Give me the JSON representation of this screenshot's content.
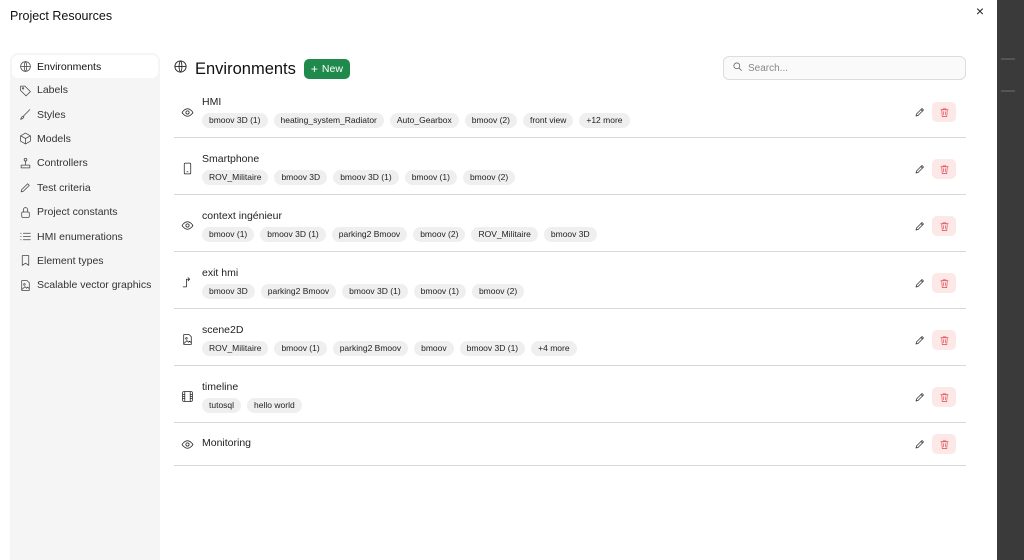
{
  "modal": {
    "title": "Project Resources",
    "close_glyph": "×"
  },
  "sidebar": {
    "items": [
      {
        "label": "Environments",
        "icon": "globe-icon",
        "active": true
      },
      {
        "label": "Labels",
        "icon": "tag-icon"
      },
      {
        "label": "Styles",
        "icon": "brush-icon"
      },
      {
        "label": "Models",
        "icon": "cube-icon"
      },
      {
        "label": "Controllers",
        "icon": "joystick-icon"
      },
      {
        "label": "Test criteria",
        "icon": "pencil-icon"
      },
      {
        "label": "Project constants",
        "icon": "lock-icon"
      },
      {
        "label": "HMI enumerations",
        "icon": "list-icon"
      },
      {
        "label": "Element types",
        "icon": "bookmark-icon"
      },
      {
        "label": "Scalable vector graphics",
        "icon": "image-file-icon"
      }
    ]
  },
  "main": {
    "title": "Environments",
    "title_icon": "globe-icon",
    "new_label": "New",
    "new_glyph": "+"
  },
  "search": {
    "placeholder": "Search..."
  },
  "environments": [
    {
      "name": "HMI",
      "icon": "eye-icon",
      "tags": [
        "bmoov 3D (1)",
        "heating_system_Radiator",
        "Auto_Gearbox",
        "bmoov (2)",
        "front view",
        "+12 more"
      ]
    },
    {
      "name": "Smartphone",
      "icon": "smartphone-icon",
      "tags": [
        "ROV_Militaire",
        "bmoov 3D",
        "bmoov 3D (1)",
        "bmoov (1)",
        "bmoov (2)"
      ]
    },
    {
      "name": "context ingénieur",
      "icon": "eye-icon",
      "tags": [
        "bmoov (1)",
        "bmoov 3D (1)",
        "parking2 Bmoov",
        "bmoov (2)",
        "ROV_Militaire",
        "bmoov 3D"
      ]
    },
    {
      "name": "exit hmi",
      "icon": "exit-arrow-icon",
      "tags": [
        "bmoov 3D",
        "parking2 Bmoov",
        "bmoov 3D (1)",
        "bmoov (1)",
        "bmoov (2)"
      ]
    },
    {
      "name": "scene2D",
      "icon": "image-file-icon",
      "tags": [
        "ROV_Militaire",
        "bmoov (1)",
        "parking2 Bmoov",
        "bmoov",
        "bmoov 3D (1)",
        "+4 more"
      ]
    },
    {
      "name": "timeline",
      "icon": "film-icon",
      "tags": [
        "tutosql",
        "hello world"
      ]
    },
    {
      "name": "Monitoring",
      "icon": "eye-icon",
      "tags": []
    }
  ],
  "colors": {
    "accent": "#1f8a4c",
    "danger": "#e0454b",
    "danger_bg": "#fde8e8",
    "sidebar_bg": "#f5f5f5",
    "chip_bg": "#efefef"
  }
}
